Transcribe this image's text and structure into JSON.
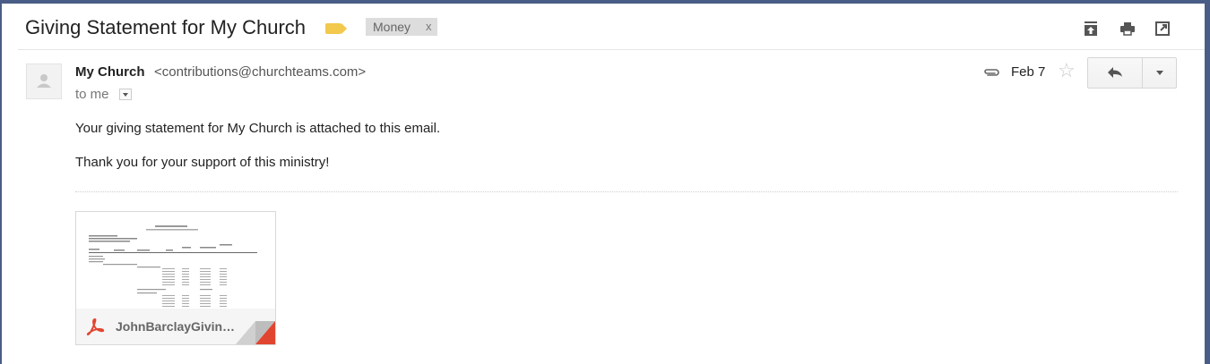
{
  "subject": "Giving Statement for My Church",
  "label_chip": {
    "name": "Money",
    "remove": "x"
  },
  "colors": {
    "label_tag": "#f2c94c",
    "pdf_red": "#e2452f",
    "window_border": "#4a5d86"
  },
  "toolbar_icons": [
    "archive-icon",
    "print-icon",
    "open-in-new-window-icon"
  ],
  "message": {
    "sender_name": "My Church",
    "sender_email": "<contributions@churchteams.com>",
    "recipient": "to me",
    "date": "Feb 7",
    "body": [
      "Your giving statement for My Church is attached to this email.",
      "Thank you for your support of this ministry!"
    ]
  },
  "attachment": {
    "filename": "JohnBarclayGivin…",
    "type_icon": "pdf-icon"
  }
}
